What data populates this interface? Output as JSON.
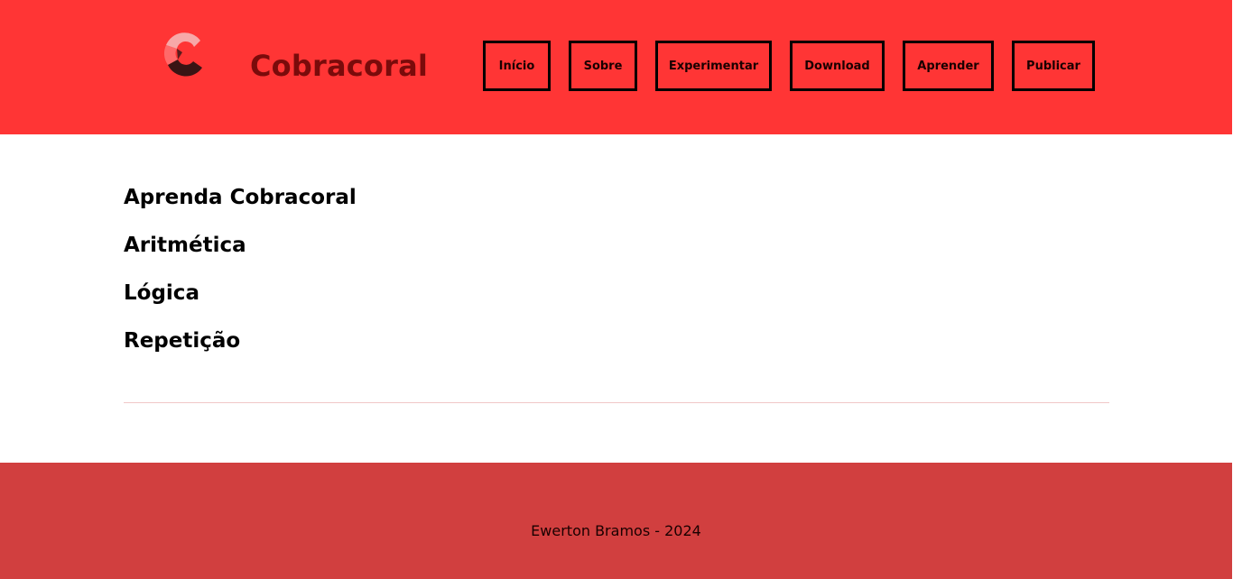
{
  "header": {
    "brand_name": "Cobracoral",
    "colors": {
      "background": "#ff3535",
      "brand_text": "#7a0b0b"
    },
    "logo_icon": "cobracoral-c-logo-icon"
  },
  "nav": {
    "items": [
      {
        "label": "Início"
      },
      {
        "label": "Sobre"
      },
      {
        "label": "Experimentar"
      },
      {
        "label": "Download"
      },
      {
        "label": "Aprender"
      },
      {
        "label": "Publicar"
      }
    ]
  },
  "main": {
    "title": "Aprenda Cobracoral",
    "lessons": [
      {
        "label": "Aritmética"
      },
      {
        "label": "Lógica"
      },
      {
        "label": "Repetição"
      }
    ]
  },
  "footer": {
    "text": "Ewerton Bramos - 2024",
    "colors": {
      "background": "#d13f3f"
    }
  }
}
